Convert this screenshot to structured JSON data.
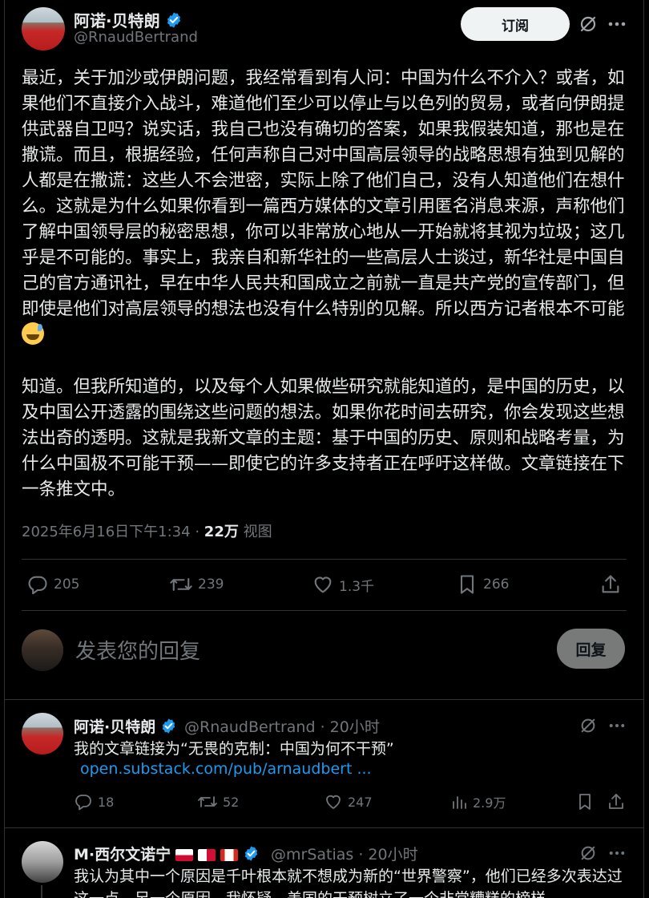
{
  "main_post": {
    "author_name": "阿诺·贝特朗",
    "author_handle": "@RnaudBertrand",
    "subscribe_label": "订阅",
    "paragraphs": [
      "最近，关于加沙或伊朗问题，我经常看到有人问：中国为什么不介入？或者，如果他们不直接介入战斗，难道他们至少可以停止与以色列的贸易，或者向伊朗提供武器自卫吗？说实话，我自己也没有确切的答案，如果我假装知道，那也是在撒谎。而且，根据经验，任何声称自己对中国高层领导的战略思想有独到见解的人都是在撒谎：这些人不会泄密，实际上除了他们自己，没有人知道他们在想什么。这就是为什么如果你看到一篇西方媒体的文章引用匿名消息来源，声称他们了解中国领导层的秘密思想，你可以非常放心地从一开始就将其视为垃圾；这几乎是不可能的。事实上，我亲自和新华社的一些高层人士谈过，新华社是中国自己的官方通讯社，早在中华人民共和国成立之前就一直是共产党的宣传部门，但即使是他们对高层领导的想法也没有什么特别的见解。所以西方记者根本不可能",
      "知道。但我所知道的，以及每个人如果做些研究就能知道的，是中国的历史，以及中国公开透露的围绕这些问题的想法。如果你花时间去研究，你会发现这些想法出奇的透明。这就是我新文章的主题：基于中国的历史、原则和战略考量，为什么中国极不可能干预——即使它的许多支持者正在呼吁这样做。文章链接在下一条推文中。"
    ],
    "timestamp": "2025年6月16日下午1:34",
    "views_count": "22万",
    "views_label": "视图",
    "separator": "·",
    "replies": "205",
    "reposts": "239",
    "likes": "1.3千",
    "bookmarks": "266"
  },
  "reply_box": {
    "placeholder": "发表您的回复",
    "button_label": "回复"
  },
  "replies": [
    {
      "name": "阿诺·贝特朗",
      "handle": "@RnaudBertrand",
      "time": "· 20小时",
      "text": "我的文章链接为“无畏的克制：中国为何不干预”",
      "link": "open.substack.com/pub/arnaudbert ...",
      "replies": "18",
      "reposts": "52",
      "likes": "247",
      "views": "2.9万"
    },
    {
      "name": "M·西尔文诺宁",
      "handle": "@mrSatias",
      "time": "· 20小时",
      "text": "我认为其中一个原因是千叶根本就不想成为新的“世界警察”，他们已经多次表达过这一点。另一个原因，我怀疑，美国的干预树立了一个非常糟糕的榜样"
    }
  ],
  "colors": {
    "background": "#000000",
    "text": "#e7e9ea",
    "muted": "#71767b",
    "verified": "#1d9bf0",
    "link": "#1d9bf0",
    "divider": "#2f3336"
  }
}
